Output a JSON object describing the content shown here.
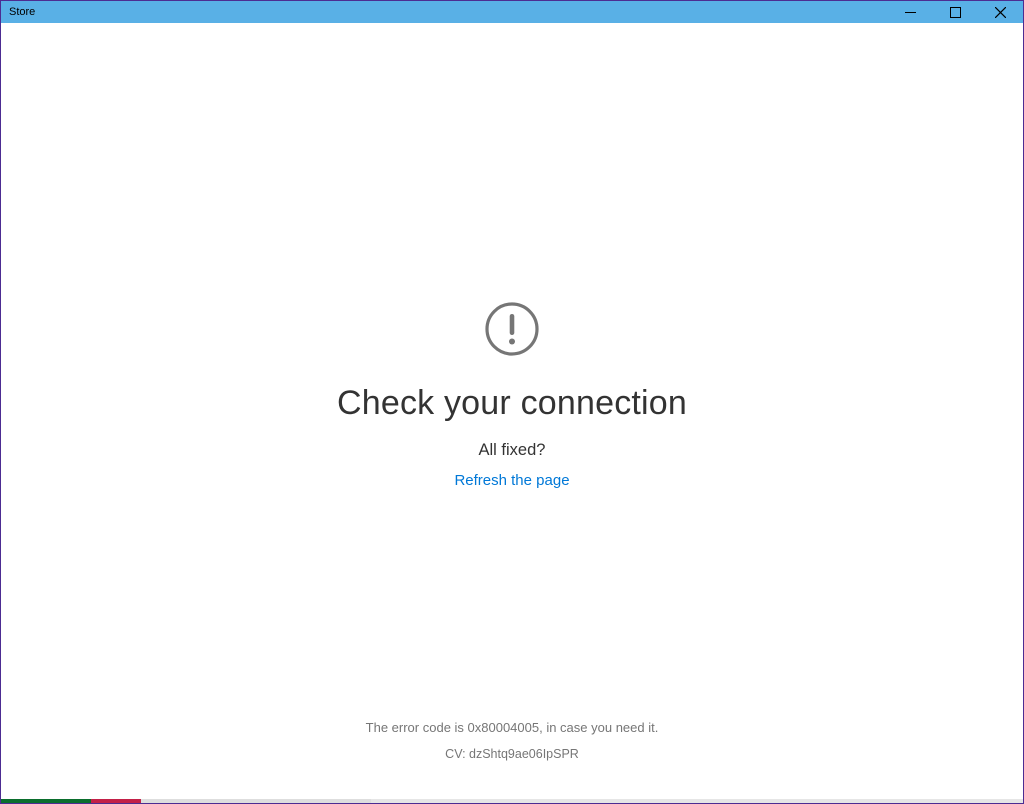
{
  "window": {
    "title": "Store"
  },
  "error": {
    "heading": "Check your connection",
    "subheading": "All fixed?",
    "refresh_link": "Refresh the page",
    "code_text": "The error code is 0x80004005, in case you need it.",
    "cv_text": "CV: dzShtq9ae06IpSPR"
  }
}
